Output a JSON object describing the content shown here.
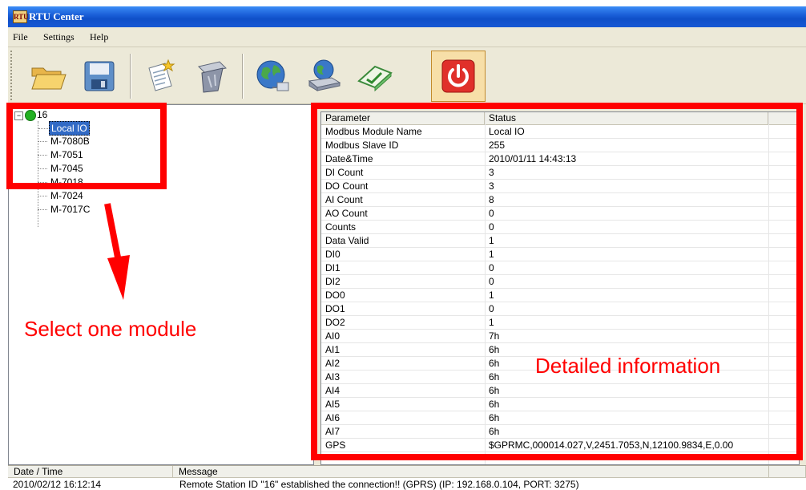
{
  "window": {
    "title": "RTU Center",
    "icon_text": "RTU"
  },
  "menu": [
    "File",
    "Settings",
    "Help"
  ],
  "toolbar": {
    "buttons": [
      "open-folder-icon",
      "save-disk-icon",
      "new-document-star-icon",
      "recycle-bin-icon",
      "globe-network-icon",
      "network-device-icon",
      "open-book-check-icon",
      "power-icon"
    ],
    "active": "power-icon"
  },
  "tree": {
    "root": "16",
    "items": [
      "Local IO",
      "M-7080B",
      "M-7051",
      "M-7045",
      "M-7018",
      "M-7024",
      "M-7017C"
    ],
    "selected": "Local IO"
  },
  "grid": {
    "columns": [
      "Parameter",
      "Status"
    ],
    "rows": [
      [
        "Modbus Module Name",
        "Local IO"
      ],
      [
        "Modbus Slave ID",
        "255"
      ],
      [
        "Date&Time",
        "2010/01/11  14:43:13"
      ],
      [
        "DI Count",
        "3"
      ],
      [
        "DO Count",
        "3"
      ],
      [
        "AI Count",
        "8"
      ],
      [
        "AO Count",
        "0"
      ],
      [
        "Counts",
        "0"
      ],
      [
        "Data Valid",
        "1"
      ],
      [
        "DI0",
        "1"
      ],
      [
        "DI1",
        "0"
      ],
      [
        "DI2",
        "0"
      ],
      [
        "DO0",
        "1"
      ],
      [
        "DO1",
        "0"
      ],
      [
        "DO2",
        "1"
      ],
      [
        "AI0",
        "7h"
      ],
      [
        "AI1",
        "6h"
      ],
      [
        "AI2",
        "6h"
      ],
      [
        "AI3",
        "6h"
      ],
      [
        "AI4",
        "6h"
      ],
      [
        "AI5",
        "6h"
      ],
      [
        "AI6",
        "6h"
      ],
      [
        "AI7",
        "6h"
      ],
      [
        "GPS",
        "$GPRMC,000014.027,V,2451.7053,N,12100.9834,E,0.00"
      ]
    ]
  },
  "log": {
    "columns": [
      "Date / Time",
      "Message"
    ],
    "rows": [
      [
        "2010/02/12  16:12:14",
        "Remote Station ID \"16\" established the connection!! (GPRS) (IP: 192.168.0.104, PORT: 3275)"
      ]
    ]
  },
  "annotations": {
    "left": "Select one module",
    "right": "Detailed information"
  },
  "colors": {
    "annotation": "#ff0000",
    "selection": "#316ac5",
    "titlebar": "#0f4fc8",
    "status_led": "#22b022"
  }
}
